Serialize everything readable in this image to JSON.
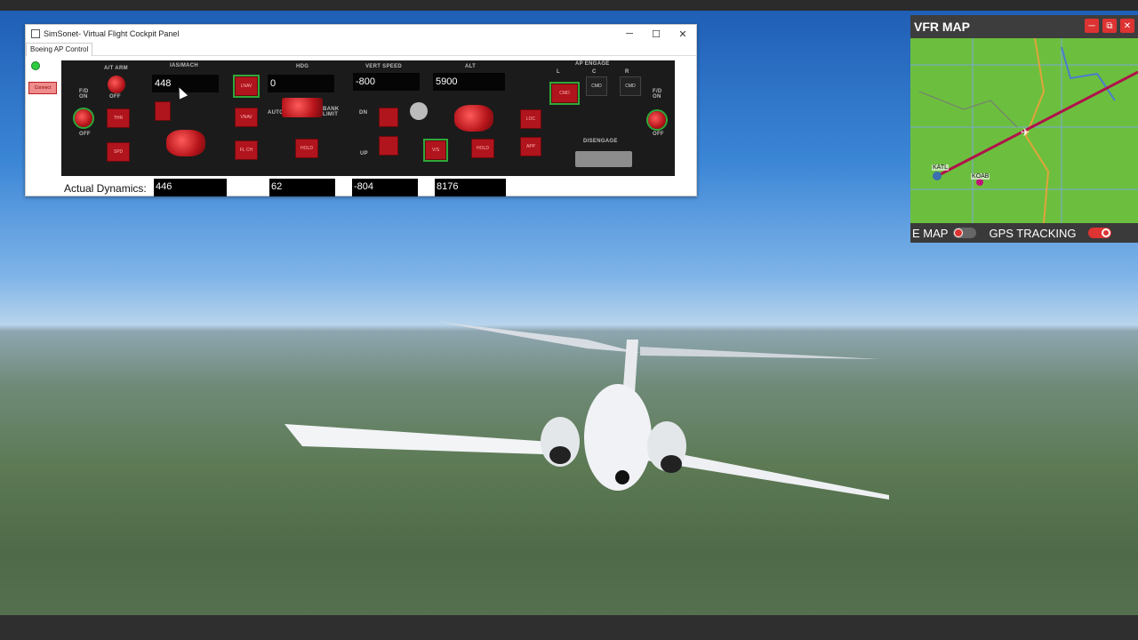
{
  "window": {
    "title": "SimSonet- Virtual Flight Cockpit Panel",
    "controls": {
      "minimize": "─",
      "maximize": "☐",
      "close": "✕"
    },
    "tab": "Boeing AP Control",
    "connect_label": "Connect"
  },
  "panel": {
    "labels": {
      "at_arm": "A/T ARM",
      "ias_mach": "IAS/MACH",
      "hdg": "HDG",
      "vert_speed": "VERT SPEED",
      "alt": "ALT",
      "ap_engage": "AP ENGAGE",
      "l": "L",
      "c": "C",
      "r": "R",
      "fd_on": "F/D ON",
      "off": "OFF",
      "bank_limit": "BANK LIMIT",
      "auto": "AUTO",
      "dn": "DN",
      "up": "UP",
      "disengage": "DISENGAGE"
    },
    "displays": {
      "ias_mach": "448",
      "hdg": "0",
      "vert_speed": "-800",
      "alt": "5900"
    },
    "buttons": {
      "thr": "THR",
      "spd": "SPD",
      "lnav": "LNAV",
      "vnav": "VNAV",
      "flch": "FL CH",
      "hdg_hold": "HOLD",
      "vs": "V/S",
      "alt_hold": "HOLD",
      "loc": "LOC",
      "app": "APP",
      "cmd_l": "CMD",
      "cmd_c": "CMD",
      "cmd_r": "CMD"
    }
  },
  "dynamics": {
    "label": "Actual Dynamics:",
    "speed": "446",
    "heading": "62",
    "vert_speed": "-804",
    "altitude": "8176"
  },
  "map": {
    "title": "VFR MAP",
    "controls": {
      "minimize": "─",
      "popout": "⧉",
      "close": "✕"
    },
    "airports": {
      "katl": "KATL",
      "koab": "KOAB"
    },
    "footer_left": "E MAP",
    "footer_right": "GPS TRACKING"
  },
  "colors": {
    "panel_bg": "#1b1b1b",
    "button_red": "#b0141c",
    "active_green": "#2ea83a",
    "map_green": "#6cbf3e",
    "track_line": "#b0124a"
  }
}
